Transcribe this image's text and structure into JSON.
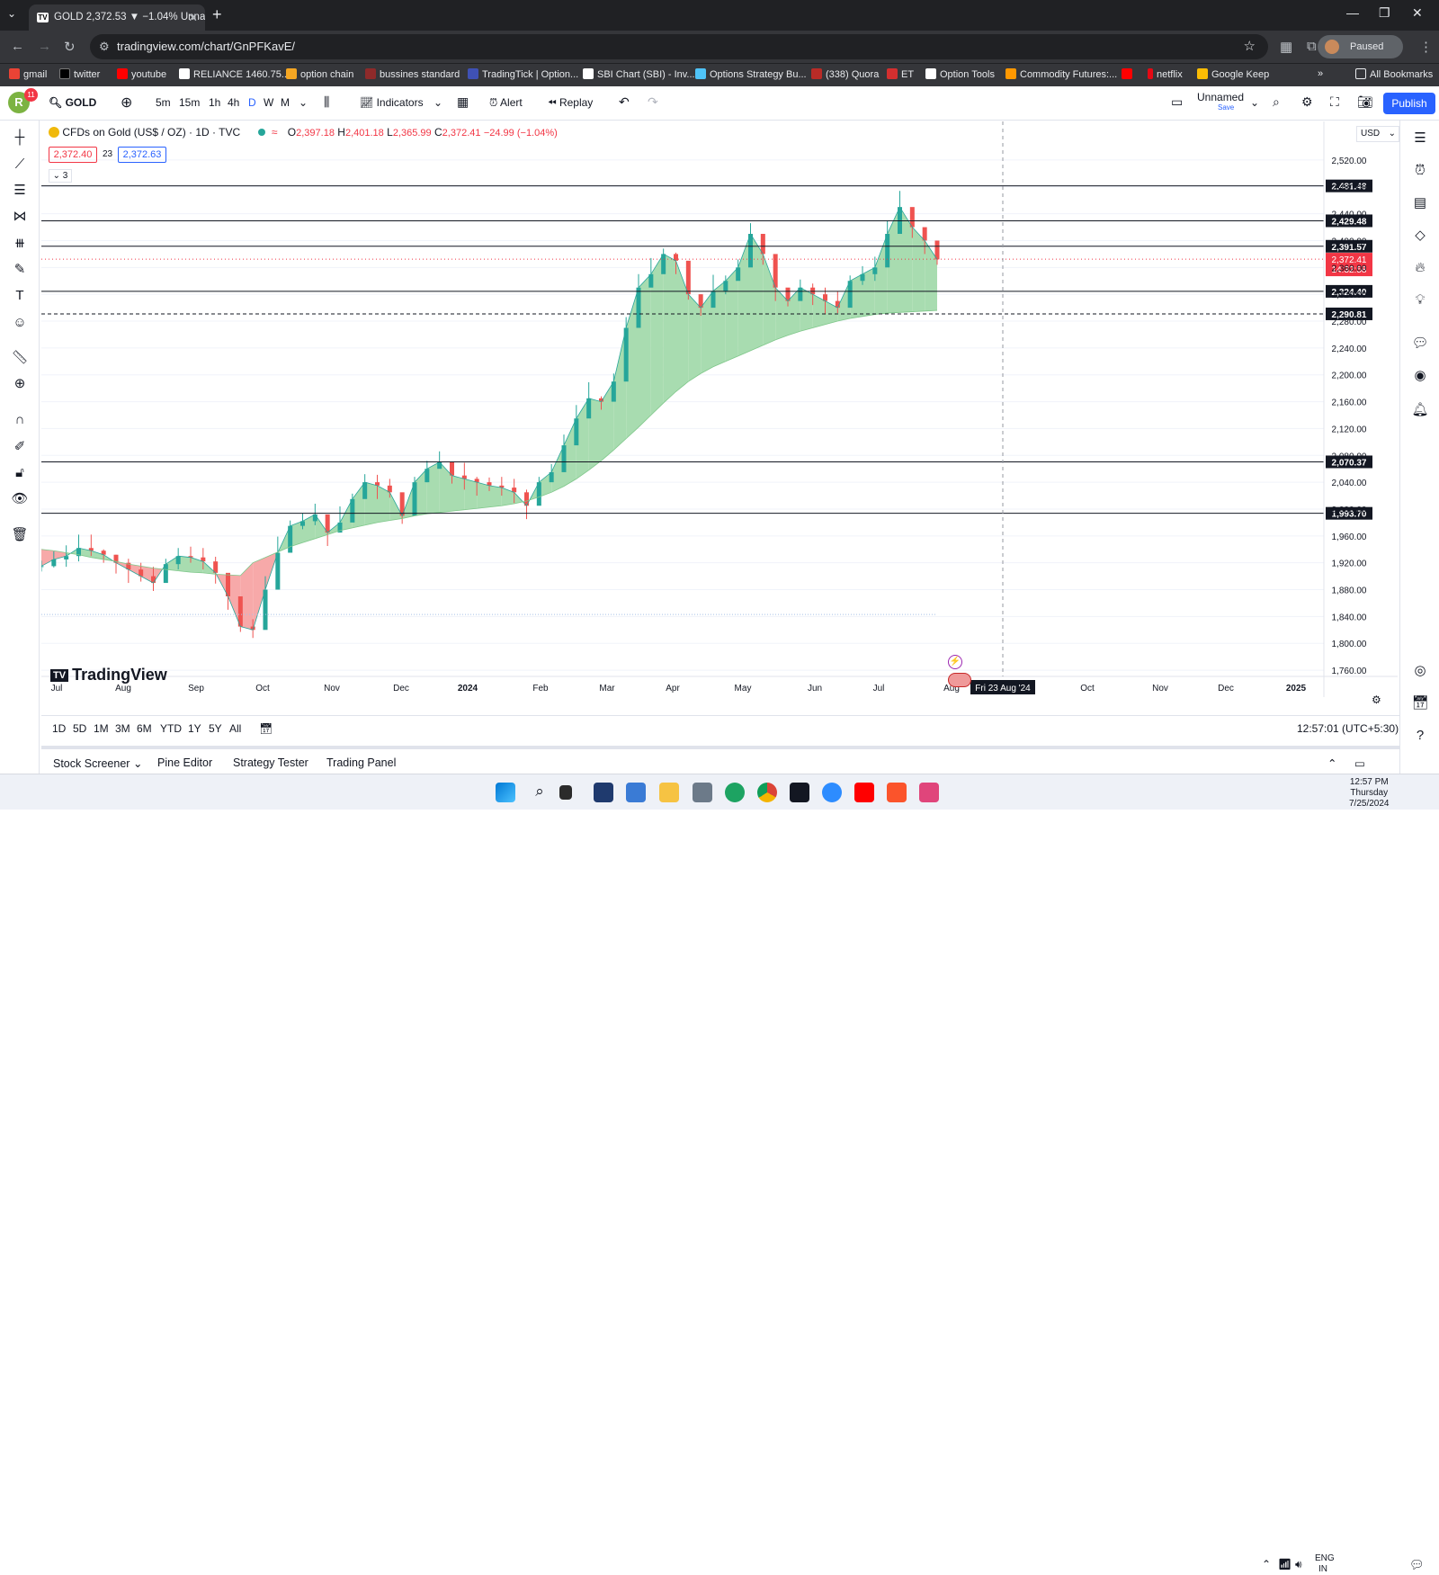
{
  "browser": {
    "tab_title": "GOLD 2,372.53 ▼ −1.04% Unna",
    "tab_favicon": "TV",
    "url": "tradingview.com/chart/GnPFKavE/",
    "profile_status": "Paused",
    "bookmarks": [
      "gmail",
      "twitter",
      "youtube",
      "RELIANCE 1460.75...",
      "option chain",
      "bussines standard",
      "TradingTick | Option...",
      "SBI Chart (SBI) - Inv...",
      "Options Strategy Bu...",
      "(338) Quora",
      "ET",
      "Option Tools",
      "Commodity Futures:...",
      "netflix",
      "Google Keep"
    ],
    "all_bookmarks": "All Bookmarks"
  },
  "toolbar": {
    "avatar_letter": "R",
    "notif_count": "11",
    "symbol": "GOLD",
    "intervals": [
      "5m",
      "15m",
      "1h",
      "4h",
      "D",
      "W",
      "M"
    ],
    "active_interval": "D",
    "indicators_label": "Indicators",
    "alert_label": "Alert",
    "replay_label": "Replay",
    "layout_name": "Unnamed",
    "save_label": "Save",
    "publish_label": "Publish"
  },
  "legend": {
    "title": "CFDs on Gold (US$ / OZ) · 1D · TVC",
    "open_label": "O",
    "open": "2,397.18",
    "high_label": "H",
    "high": "2,401.18",
    "low_label": "L",
    "low": "2,365.99",
    "close_label": "C",
    "close": "2,372.41",
    "change": "−24.99 (−1.04%)",
    "bid": "2,372.40",
    "spread": "23",
    "ask": "2,372.63",
    "collapsed_count": "3"
  },
  "watermark": "TradingView",
  "currency": "USD",
  "chart_data": {
    "type": "line",
    "symbol": "GOLD",
    "interval": "1D",
    "ylim": [
      1740,
      2540
    ],
    "y_ticks": [
      "2,520.00",
      "2,480.00",
      "2,440.00",
      "2,400.00",
      "2,360.00",
      "2,320.00",
      "2,280.00",
      "2,240.00",
      "2,200.00",
      "2,160.00",
      "2,120.00",
      "2,080.00",
      "2,040.00",
      "2,000.00",
      "1,960.00",
      "1,920.00",
      "1,880.00",
      "1,840.00",
      "1,800.00",
      "1,760.00"
    ],
    "x_ticks": [
      "Jul",
      "Aug",
      "Sep",
      "Oct",
      "Nov",
      "Dec",
      "2024",
      "Feb",
      "Mar",
      "Apr",
      "May",
      "Jun",
      "Jul",
      "Aug",
      "Oct",
      "Nov",
      "Dec",
      "2025"
    ],
    "crosshair_date": "Fri 23 Aug '24",
    "series": [
      {
        "name": "price",
        "values": [
          1915,
          1925,
          1930,
          1942,
          1938,
          1932,
          1920,
          1910,
          1900,
          1890,
          1918,
          1930,
          1928,
          1922,
          1905,
          1870,
          1825,
          1820,
          1880,
          1935,
          1975,
          1982,
          1992,
          1965,
          1980,
          2015,
          2040,
          2035,
          2025,
          1990,
          2040,
          2060,
          2070,
          2050,
          2045,
          2040,
          2035,
          2032,
          2025,
          2005,
          2040,
          2055,
          2095,
          2135,
          2165,
          2160,
          2190,
          2270,
          2330,
          2350,
          2380,
          2370,
          2320,
          2300,
          2325,
          2340,
          2360,
          2410,
          2380,
          2330,
          2310,
          2330,
          2320,
          2310,
          2300,
          2340,
          2350,
          2360,
          2410,
          2450,
          2420,
          2400,
          2372
        ]
      },
      {
        "name": "moving-average",
        "values": [
          1940,
          1938,
          1935,
          1932,
          1928,
          1925,
          1922,
          1918,
          1915,
          1912,
          1910,
          1908,
          1906,
          1905,
          1903,
          1902,
          1901,
          1920,
          1928,
          1936,
          1944,
          1950,
          1956,
          1962,
          1968,
          1972,
          1976,
          1980,
          1983,
          1986,
          1990,
          1993,
          1995,
          1997,
          1999,
          2001,
          2003,
          2005,
          2008,
          2012,
          2018,
          2025,
          2034,
          2045,
          2058,
          2072,
          2088,
          2105,
          2122,
          2140,
          2158,
          2175,
          2190,
          2202,
          2212,
          2220,
          2228,
          2236,
          2244,
          2252,
          2259,
          2265,
          2270,
          2275,
          2280,
          2284,
          2287,
          2290,
          2292,
          2293,
          2294,
          2295,
          2296
        ]
      }
    ],
    "horizontal_levels": [
      {
        "value": 2481.48,
        "label": "2,481.48"
      },
      {
        "value": 2429.48,
        "label": "2,429.48"
      },
      {
        "value": 2391.57,
        "label": "2,391.57"
      },
      {
        "value": 2324.4,
        "label": "2,324.40"
      },
      {
        "value": 2290.81,
        "label": "2,290.81"
      },
      {
        "value": 2070.37,
        "label": "2,070.37"
      },
      {
        "value": 1993.7,
        "label": "1,993.70"
      }
    ],
    "last_price": {
      "value": 2372.41,
      "label": "2,372.41",
      "countdown": "14:32:58"
    },
    "colors": {
      "up_fill": "#a8dcb0",
      "down_fill": "#f7a9a9",
      "up": "#26a69a",
      "down": "#ef5350",
      "level": "#131722"
    }
  },
  "range_buttons": [
    "1D",
    "5D",
    "1M",
    "3M",
    "6M",
    "YTD",
    "1Y",
    "5Y",
    "All"
  ],
  "timestamp": "12:57:01 (UTC+5:30)",
  "panels": [
    "Stock Screener",
    "Pine Editor",
    "Strategy Tester",
    "Trading Panel"
  ],
  "taskbar": {
    "time": "12:57 PM",
    "day": "Thursday",
    "date": "7/25/2024",
    "lang": "ENG",
    "region": "IN"
  }
}
